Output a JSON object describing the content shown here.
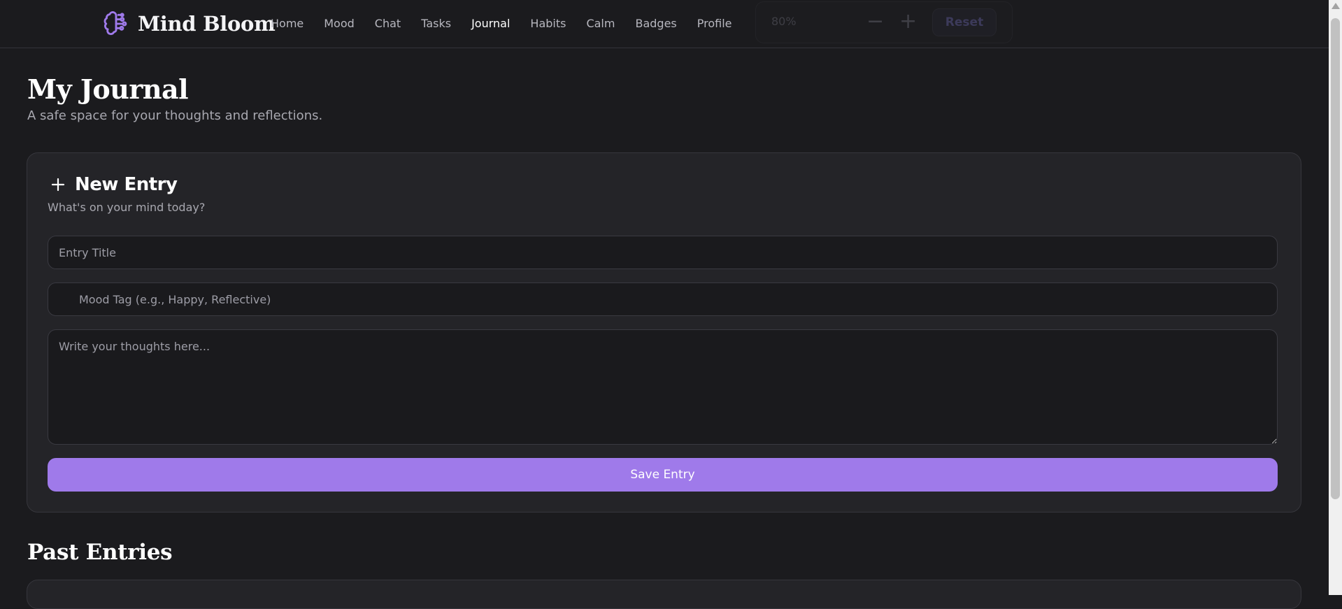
{
  "app": {
    "name": "Mind Bloom"
  },
  "nav": {
    "items": [
      {
        "label": "Home"
      },
      {
        "label": "Mood"
      },
      {
        "label": "Chat"
      },
      {
        "label": "Tasks"
      },
      {
        "label": "Journal",
        "active": true
      },
      {
        "label": "Habits"
      },
      {
        "label": "Calm"
      },
      {
        "label": "Badges"
      },
      {
        "label": "Profile"
      }
    ]
  },
  "zoom": {
    "value": "80%",
    "minus": "−",
    "plus": "+",
    "reset_label": "Reset"
  },
  "page": {
    "title": "My Journal",
    "subtitle": "A safe space for your thoughts and reflections."
  },
  "new_entry": {
    "title": "New Entry",
    "subtitle": "What's on your mind today?",
    "title_placeholder": "Entry Title",
    "title_value": "",
    "mood_placeholder": "Mood Tag (e.g., Happy, Reflective)",
    "mood_value": "",
    "body_placeholder": "Write your thoughts here...",
    "body_value": "",
    "save_label": "Save Entry"
  },
  "past_entries": {
    "title": "Past Entries"
  },
  "colors": {
    "accent": "#9f7aea",
    "background": "#1b1b1e",
    "card": "#242428"
  },
  "icons": {
    "logo": "brain-icon",
    "new_entry": "plus-icon",
    "mood": "tag-icon"
  }
}
